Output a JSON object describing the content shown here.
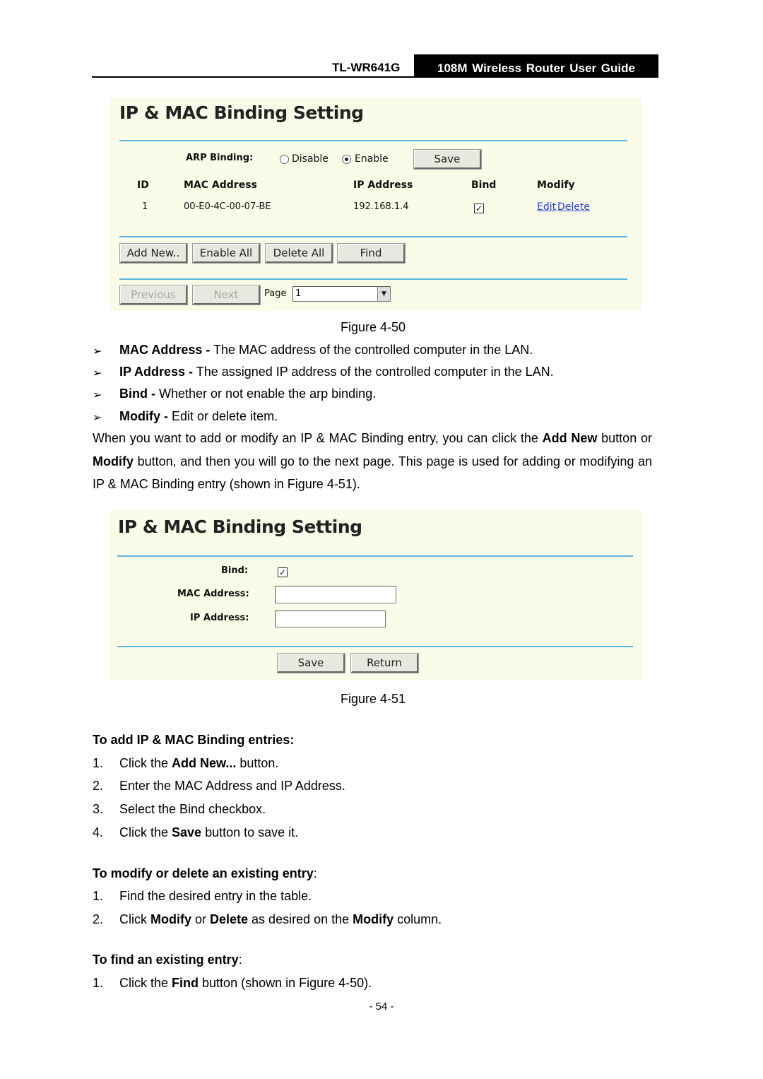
{
  "header": {
    "model": "TL-WR641G",
    "guide_title": "108M Wireless Router User Guide"
  },
  "figure_50": {
    "title": "IP & MAC Binding Setting",
    "arp_binding_label": "ARP Binding:",
    "radio_disable": "Disable",
    "radio_enable": "Enable",
    "arp_selected": "Enable",
    "save_label": "Save",
    "columns": [
      "ID",
      "MAC Address",
      "IP Address",
      "Bind",
      "Modify"
    ],
    "rows": [
      {
        "id": "1",
        "mac": "00-E0-4C-00-07-BE",
        "ip": "192.168.1.4",
        "bind": true,
        "edit": "Edit",
        "delete": "Delete"
      }
    ],
    "buttons": {
      "add_new": "Add New..",
      "enable_all": "Enable All",
      "delete_all": "Delete All",
      "find": "Find"
    },
    "pager": {
      "previous": "Previous",
      "next": "Next",
      "page_label": "Page",
      "page_value": "1"
    },
    "caption": "Figure 4-50"
  },
  "bullets": [
    {
      "term": "MAC Address -",
      "text": " The MAC address of the controlled computer in the LAN."
    },
    {
      "term": "IP Address -",
      "text": " The assigned IP address of the controlled computer in the LAN."
    },
    {
      "term": "Bind -",
      "text": " Whether or not enable the arp binding."
    },
    {
      "term": "Modify -",
      "text": " Edit or delete item."
    }
  ],
  "bullet_glyph": "➢",
  "paragraph": {
    "p1": "When you want to add or modify an IP & MAC Binding entry, you can click the ",
    "b1": "Add New",
    "p2": " button or ",
    "b2": "Modify",
    "p3": " button, and then you will go to the next page. This page is used for adding or modifying an IP & MAC Binding entry (shown in Figure 4-51)."
  },
  "figure_51": {
    "title": "IP & MAC Binding Setting",
    "bind_label": "Bind:",
    "bind_checked": true,
    "mac_label": "MAC Address:",
    "mac_value": "",
    "ip_label": "IP Address:",
    "ip_value": "",
    "save_label": "Save",
    "return_label": "Return",
    "caption": "Figure 4-51"
  },
  "add_section": {
    "heading": "To add IP & MAC Binding entries:",
    "steps": [
      {
        "n": "1.",
        "pre": "Click the ",
        "bold": "Add New...",
        "post": " button."
      },
      {
        "n": "2.",
        "pre": "Enter the MAC Address and IP Address.",
        "bold": "",
        "post": ""
      },
      {
        "n": "3.",
        "pre": "Select the Bind checkbox.",
        "bold": "",
        "post": ""
      },
      {
        "n": "4.",
        "pre": "Click the ",
        "bold": "Save",
        "post": " button to save it."
      }
    ]
  },
  "modify_section": {
    "heading": "To modify or delete an existing entry",
    "colon": ":",
    "step1": {
      "n": "1.",
      "text": "Find the desired entry in the table."
    },
    "step2": {
      "n": "2.",
      "a": "Click ",
      "b1": "Modify",
      "c": " or ",
      "b2": "Delete",
      "d": " as desired on the ",
      "b3": "Modify",
      "e": " column."
    }
  },
  "find_section": {
    "heading": "To find an existing entry",
    "colon": ":",
    "step1": {
      "n": "1.",
      "a": "Click the ",
      "b": "Find",
      "c": " button (shown in Figure 4-50)."
    }
  },
  "page_number": "- 54 -"
}
